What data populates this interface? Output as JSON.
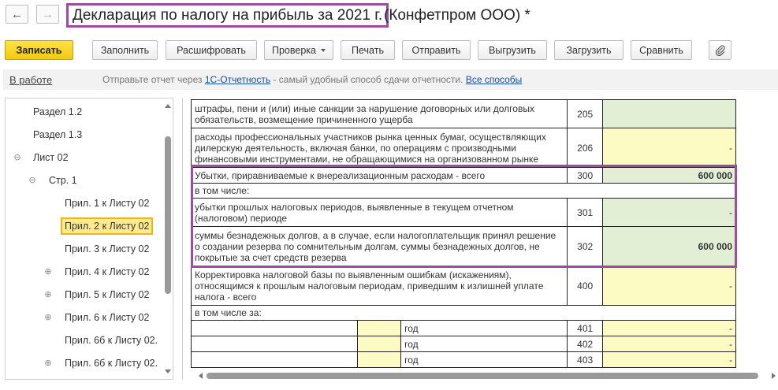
{
  "window": {
    "title_main": "Декларация по налогу на прибыль за 2021 г.",
    "title_rest": "(Конфетпром ООО) *",
    "back_icon": "arrow-left-icon",
    "forward_icon": "arrow-right-icon"
  },
  "toolbar": {
    "record": "Записать",
    "fill": "Заполнить",
    "decode": "Расшифровать",
    "check": "Проверка",
    "print": "Печать",
    "send": "Отправить",
    "unload": "Выгрузить",
    "load": "Загрузить",
    "compare": "Сравнить",
    "attach_icon": "paperclip-icon"
  },
  "status": {
    "state": "В работе",
    "msg_prefix": "Отправьте отчет через",
    "msg_link": "1С-Отчетность",
    "msg_middle": "- самый удобный способ сдачи отчетности.",
    "msg_all": "Все способы"
  },
  "tree": {
    "items": [
      {
        "label": "Раздел 1.2",
        "expander": ""
      },
      {
        "label": "Раздел 1.3",
        "expander": ""
      },
      {
        "label": "Лист 02",
        "expander": "⊖"
      },
      {
        "label": "Стр. 1",
        "expander": "⊖"
      },
      {
        "label": "Прил. 1 к Листу 02",
        "expander": ""
      },
      {
        "label": "Прил. 2 к Листу 02",
        "expander": "",
        "selected": true
      },
      {
        "label": "Прил. 3 к Листу 02",
        "expander": ""
      },
      {
        "label": "Прил. 4 к Листу 02",
        "expander": "⊕"
      },
      {
        "label": "Прил. 5 к Листу 02",
        "expander": "⊕"
      },
      {
        "label": "Прил. 6 к Листу 02",
        "expander": "⊕"
      },
      {
        "label": "Прил. 6б к Листу 02.",
        "expander": ""
      },
      {
        "label": "Прил. 6б к Листу 02.",
        "expander": "⊕"
      }
    ]
  },
  "form": {
    "rows": {
      "r205": {
        "text": "штрафы, пени и (или) иные санкции за нарушение договорных или долговых обязательств, возмещение причиненного ущерба",
        "code": "205",
        "value": ""
      },
      "r206": {
        "text": "расходы профессиональных участников рынка ценных бумаг, осуществляющих дилерскую деятельность, включая банки, по операциям с производными финансовыми инструментами, не обращающимися на организованном рынке",
        "code": "206",
        "value": "-"
      },
      "r300": {
        "text": "Убытки, приравниваемые к внереализационным расходам - всего",
        "code": "300",
        "value": "600 000"
      },
      "incl": {
        "text": "в том числе:"
      },
      "r301": {
        "text": "убытки прошлых налоговых периодов, выявленные в текущем отчетном (налоговом) периоде",
        "code": "301",
        "value": "-"
      },
      "r302": {
        "text": "суммы безнадежных долгов, а в случае, если налогоплательщик принял решение о создании резерва по сомнительным долгам, суммы безнадежных долгов, не покрытые за счет средств резерва",
        "code": "302",
        "value": "600 000"
      },
      "r400": {
        "text": "Корректировка налоговой базы по выявленным ошибкам (искажениям), относящимся к прошлым налоговым периодам, приведшим к излишней уплате налога - всего",
        "code": "400",
        "value": "-"
      },
      "incl_for": {
        "text": "в том числе за:"
      },
      "r401": {
        "year_label": "год",
        "code": "401",
        "value": "-"
      },
      "r402": {
        "year_label": "год",
        "code": "402",
        "value": "-"
      },
      "r403": {
        "year_label": "год",
        "code": "403",
        "value": "-"
      }
    }
  },
  "colors": {
    "highlight": "#9b4e9e",
    "primary_button": "#f3c90e",
    "cell_green": "#e3efd5",
    "cell_yellow": "#fdfbc4",
    "link": "#1b4ea0"
  }
}
